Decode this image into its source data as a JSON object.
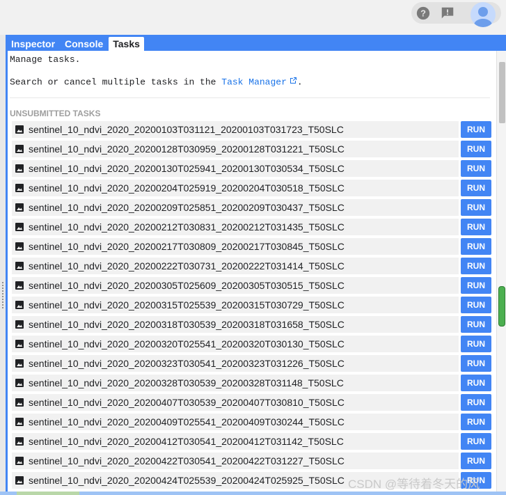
{
  "topbar": {
    "help_icon": "help-circle-icon",
    "feedback_icon": "feedback-icon",
    "avatar_icon": "user-avatar-icon"
  },
  "tabs": [
    {
      "label": "Inspector",
      "active": false
    },
    {
      "label": "Console",
      "active": false
    },
    {
      "label": "Tasks",
      "active": true
    }
  ],
  "content": {
    "manage_text": "Manage tasks.",
    "search_prefix": "Search or cancel multiple tasks in the",
    "task_manager_link": "Task Manager",
    "search_suffix": "."
  },
  "section": {
    "title": "UNSUBMITTED TASKS",
    "run_label": "RUN",
    "tasks": [
      "sentinel_10_ndvi_2020_20200103T031121_20200103T031723_T50SLC",
      "sentinel_10_ndvi_2020_20200128T030959_20200128T031221_T50SLC",
      "sentinel_10_ndvi_2020_20200130T025941_20200130T030534_T50SLC",
      "sentinel_10_ndvi_2020_20200204T025919_20200204T030518_T50SLC",
      "sentinel_10_ndvi_2020_20200209T025851_20200209T030437_T50SLC",
      "sentinel_10_ndvi_2020_20200212T030831_20200212T031435_T50SLC",
      "sentinel_10_ndvi_2020_20200217T030809_20200217T030845_T50SLC",
      "sentinel_10_ndvi_2020_20200222T030731_20200222T031414_T50SLC",
      "sentinel_10_ndvi_2020_20200305T025609_20200305T030515_T50SLC",
      "sentinel_10_ndvi_2020_20200315T025539_20200315T030729_T50SLC",
      "sentinel_10_ndvi_2020_20200318T030539_20200318T031658_T50SLC",
      "sentinel_10_ndvi_2020_20200320T025541_20200320T030130_T50SLC",
      "sentinel_10_ndvi_2020_20200323T030541_20200323T031226_T50SLC",
      "sentinel_10_ndvi_2020_20200328T030539_20200328T031148_T50SLC",
      "sentinel_10_ndvi_2020_20200407T030539_20200407T030810_T50SLC",
      "sentinel_10_ndvi_2020_20200409T025541_20200409T030244_T50SLC",
      "sentinel_10_ndvi_2020_20200412T030541_20200412T031142_T50SLC",
      "sentinel_10_ndvi_2020_20200422T030541_20200422T031227_T50SLC",
      "sentinel_10_ndvi_2020_20200424T025539_20200424T025925_T50SLC"
    ]
  },
  "watermark": "CSDN @等待着冬天的风",
  "colors": {
    "accent": "#4285f4",
    "link": "#1a73e8",
    "row_bg": "#f1f1f1"
  }
}
